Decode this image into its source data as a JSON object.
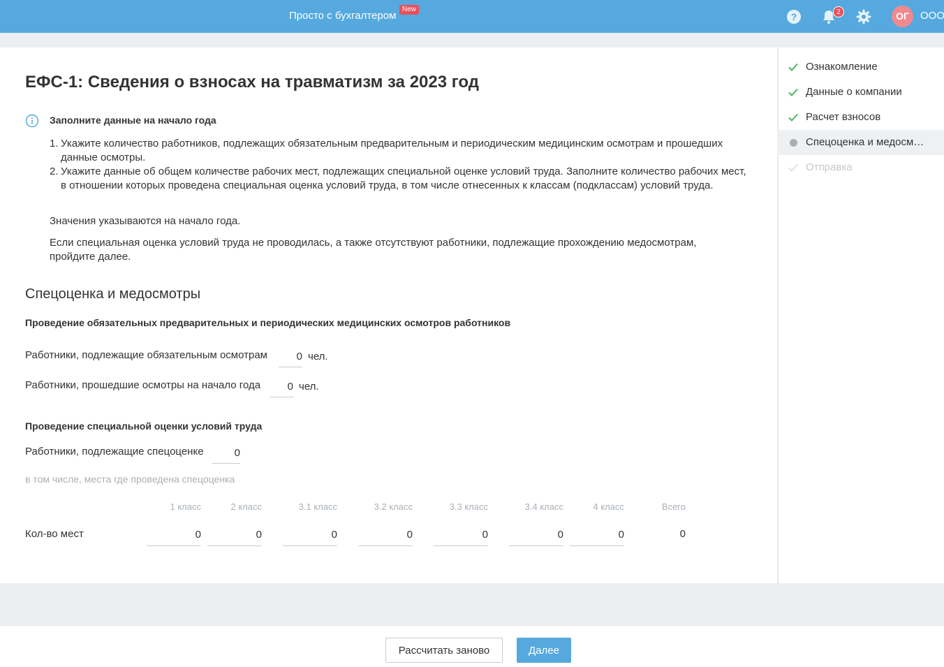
{
  "header": {
    "title": "Просто с бухгалтером",
    "new_badge": "New",
    "notifications_count": "2",
    "avatar_initials": "ОГ",
    "org_name": "ООО"
  },
  "page": {
    "title": "ЕФС-1: Сведения о взносах на травматизм за 2023 год"
  },
  "info": {
    "title": "Заполните данные на начало года",
    "items": [
      {
        "num": "1.",
        "text": "Укажите количество работников, подлежащих обязательным предварительным и периодическим медицинским осмотрам и прошедших данные осмотры."
      },
      {
        "num": "2.",
        "text": "Укажите данные об общем количестве рабочих мест, подлежащих специальной оценке условий труда. Заполните количество рабочих мест, в отношении которых проведена специальная оценка условий труда, в том числе отнесенных к классам (подклассам) условий труда."
      }
    ],
    "note1": "Значения указываются на начало года.",
    "note2": "Если специальная оценка условий труда не проводилась, а также отсутствуют работники, подлежащие прохождению медосмотрам, пройдите далее."
  },
  "section": {
    "title": "Спецоценка и медосмотры",
    "medical": {
      "heading": "Проведение обязательных предварительных и периодических медицинских осмотров работников",
      "required_label": "Работники, подлежащие обязательным осмотрам",
      "required_value": "0",
      "passed_label": "Работники, прошедшие осмотры на начало года",
      "passed_value": "0",
      "unit": "чел."
    },
    "special": {
      "heading": "Проведение специальной оценки условий труда",
      "subject_label": "Работники, подлежащие спецоценке",
      "subject_value": "0",
      "muted_note": "в том числе, места где проведена спецоценка",
      "columns": [
        "1 класс",
        "2 класс",
        "3.1 класс",
        "3.2 класс",
        "3.3 класс",
        "3.4 класс",
        "4 класс",
        "Всего"
      ],
      "row_label": "Кол-во мест",
      "values": [
        "0",
        "0",
        "0",
        "0",
        "0",
        "0",
        "0"
      ],
      "total": "0"
    }
  },
  "steps": [
    {
      "label": "Ознакомление",
      "state": "done"
    },
    {
      "label": "Данные о компании",
      "state": "done"
    },
    {
      "label": "Расчет взносов",
      "state": "done"
    },
    {
      "label": "Спецоценка и медосмотры",
      "state": "active"
    },
    {
      "label": "Отправка",
      "state": "disabled"
    }
  ],
  "footer": {
    "recalc_label": "Рассчитать заново",
    "next_label": "Далее"
  },
  "colors": {
    "brand": "#55a9de",
    "check": "#4cb85c",
    "badge": "#e8505b"
  }
}
